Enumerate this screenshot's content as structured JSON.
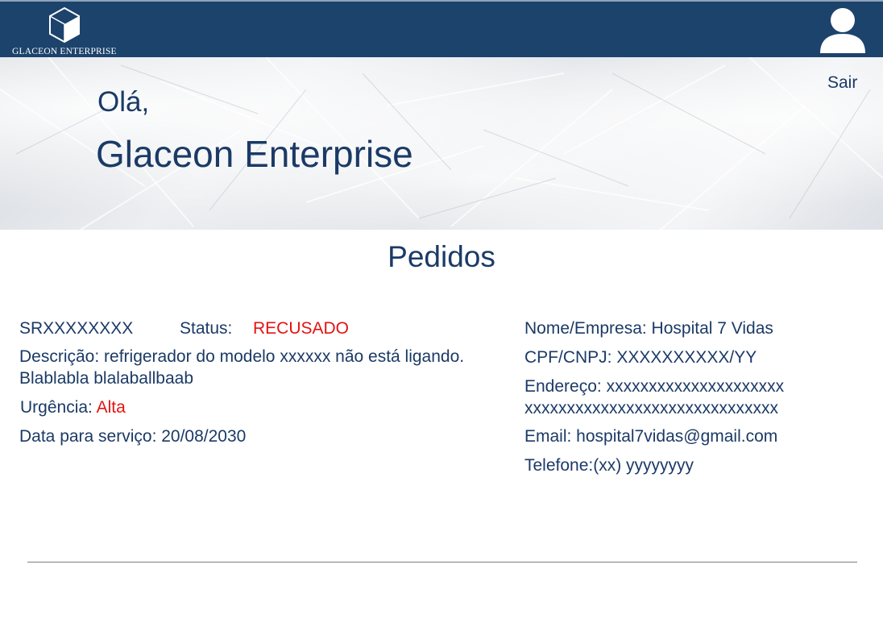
{
  "header": {
    "brand_text": "GLACEON ENTERPRISE",
    "icons": {
      "logo": "cube-logo-icon",
      "account": "user-avatar-icon"
    }
  },
  "hero": {
    "greeting": "Olá,",
    "company_name": "Glaceon Enterprise",
    "logout_label": "Sair"
  },
  "page": {
    "title": "Pedidos"
  },
  "order": {
    "id": "SRXXXXXXXX",
    "status_label": "Status:",
    "status_value": "RECUSADO",
    "description": "Descrição: refrigerador do modelo xxxxxx não está ligando. Blablabla blalaballbaab",
    "urgency_label": "Urgência:",
    "urgency_value": "Alta",
    "service_date": "Data para serviço: 20/08/2030"
  },
  "client": {
    "name": "Nome/Empresa: Hospital 7 Vidas",
    "document": "CPF/CNPJ: XXXXXXXXXX/YY",
    "address_line1": "Endereço: xxxxxxxxxxxxxxxxxxxxx",
    "address_line2": "xxxxxxxxxxxxxxxxxxxxxxxxxxxxxx",
    "email": "Email: hospital7vidas@gmail.com",
    "phone": "Telefone:(xx) yyyyyyyy"
  },
  "colors": {
    "header_bg": "#1c436c",
    "text_primary": "#1b3a66",
    "alert": "#e51212"
  }
}
